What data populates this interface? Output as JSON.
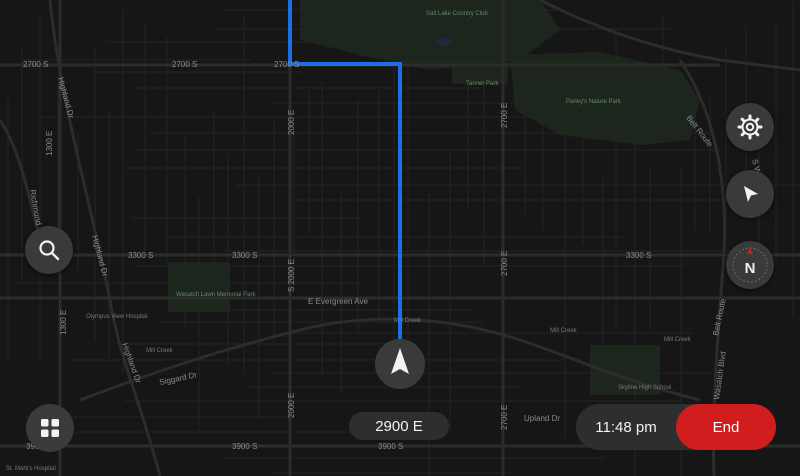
{
  "map": {
    "streets": {
      "s2700_a": "2700 S",
      "s2700_b": "2700 S",
      "s2700_c": "2700 S",
      "s3300_a": "3300 S",
      "s3300_b": "3300 S",
      "s3300_c": "3300 S",
      "s3900_a": "3900 S",
      "s3900_b": "3900 S",
      "s3900_c": "3900 S",
      "e1300_a": "1300 E",
      "e1300_b": "1300 E",
      "e2000_a": "2000 E",
      "e2000_b": "S 2000 E",
      "e2000_c": "2000 E",
      "e2700_a": "2700 E",
      "e2700_b": "2700 E",
      "e2700_c": "2700 E",
      "highland_a": "Highland Dr",
      "highland_b": "Highland Dr",
      "highland_c": "Highland Dr",
      "richmond": "Richmond",
      "evergreen": "E Evergreen Ave",
      "siggard": "Siggard Dr",
      "upland": "Upland Dr",
      "belt_route_a": "Belt Route",
      "belt_route_b": "Belt Route",
      "wasatch_blvd": "Wasatch Blvd",
      "s_wasatch": "S Wa",
      "millcreek_a": "Mill Creek",
      "millcreek_b": "Mill Creek",
      "millcreek_c": "Mill Creek",
      "millcreek_d": "Mill Creek"
    },
    "pois": {
      "country_club": "Salt Lake Country Club",
      "tanner_park": "Tanner Park",
      "parleys": "Parley's Nature Park",
      "wasatch_lawn": "Wasatch Lawn Memorial Park",
      "olympus": "Olympus View Hospital",
      "skyline": "Skyline High School",
      "st_marks": "St. Mark's Hospital"
    },
    "route_color": "#1a6fe6"
  },
  "controls": {
    "search_icon": "search-icon",
    "apps_icon": "apps-grid-icon",
    "settings_icon": "gear-icon",
    "recenter_icon": "navigation-arrow-icon",
    "compass_icon": "compass-icon",
    "compass_label": "N"
  },
  "navigation": {
    "current_street": "2900 E",
    "time": "11:48 pm",
    "end_label": "End",
    "end_color": "#d11d1d"
  }
}
